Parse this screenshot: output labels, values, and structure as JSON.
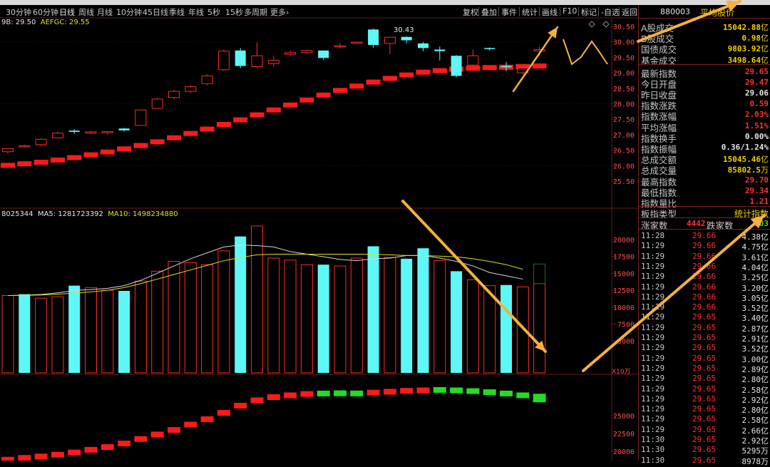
{
  "colors": {
    "up": "#ff2a2a",
    "down": "#5ef7f7",
    "ma_white": "#ffffff",
    "ma_yellow": "#e0e020",
    "grid": "#6a1a1a",
    "accent_yellow": "#f0d000",
    "arrow": "#f4b040"
  },
  "period_tabs": [
    {
      "label": "30分钟",
      "active": false
    },
    {
      "label": "60分钟",
      "active": false
    },
    {
      "label": "日线",
      "active": true
    },
    {
      "label": "周线",
      "active": false
    },
    {
      "label": "月线",
      "active": false
    },
    {
      "label": "10分钟",
      "active": false
    },
    {
      "label": "45日线",
      "active": false
    },
    {
      "label": "季线",
      "active": false
    },
    {
      "label": "年线",
      "active": false
    },
    {
      "label": "5秒",
      "active": false
    },
    {
      "label": "15秒",
      "active": false
    },
    {
      "label": "多周期",
      "active": false
    },
    {
      "label": "更多›",
      "active": false
    }
  ],
  "toolbar": [
    "复权",
    "叠加",
    "事件",
    "统计",
    "画线",
    "F10",
    "标记",
    "-自选",
    "返回"
  ],
  "legend": {
    "price": "9B: 29.50",
    "price_ma": "AEFGC: 29.55",
    "vol": "8025344",
    "vol_ma5": "MA5: 1281723392",
    "vol_ma10": "MA10: 1498234880",
    "high_label": "30.43",
    "vol_unit": "X10万"
  },
  "price_axis": [
    "30.50",
    "30.00",
    "29.50",
    "29.00",
    "28.50",
    "28.00",
    "27.50",
    "27.00",
    "26.50",
    "26.00",
    "25.50"
  ],
  "vol_axis": [
    "20000",
    "17500",
    "15000",
    "12500",
    "10000",
    "7500",
    "5000"
  ],
  "ind_axis": [
    "25000",
    "22500",
    "20000"
  ],
  "panel": {
    "code": "880003",
    "name": "平均股价",
    "stats": [
      {
        "label": "A股成交",
        "value": "15042.88",
        "unit": "亿",
        "color": "#f0d000"
      },
      {
        "label": "B股成交",
        "value": "0.98",
        "unit": "亿",
        "color": "#f0d000"
      },
      {
        "label": "国债成交",
        "value": "9803.92",
        "unit": "亿",
        "color": "#f0d000"
      },
      {
        "label": "基金成交",
        "value": "3498.64",
        "unit": "亿",
        "color": "#f0d000"
      },
      {
        "label": "最新指数",
        "value": "29.65",
        "unit": "",
        "color": "#ff3030"
      },
      {
        "label": "今日开盘",
        "value": "29.47",
        "unit": "",
        "color": "#ff3030"
      },
      {
        "label": "昨日收盘",
        "value": "29.06",
        "unit": "",
        "color": "#e6e6e6"
      },
      {
        "label": "指数涨跌",
        "value": "0.59",
        "unit": "",
        "color": "#ff3030"
      },
      {
        "label": "指数涨幅",
        "value": "2.03%",
        "unit": "",
        "color": "#ff3030"
      },
      {
        "label": "平均涨幅",
        "value": "1.51%",
        "unit": "",
        "color": "#ff3030"
      },
      {
        "label": "指数换手",
        "value": "0.00%",
        "unit": "",
        "color": "#e6e6e6"
      },
      {
        "label": "指数振幅",
        "value": "0.36/1.24%",
        "unit": "",
        "color": "#e6e6e6"
      },
      {
        "label": "总成交额",
        "value": "15045.46",
        "unit": "亿",
        "color": "#f0d000"
      },
      {
        "label": "总成交量",
        "value": "85802.5",
        "unit": "万",
        "color": "#f0d000"
      },
      {
        "label": "最高指数",
        "value": "29.70",
        "unit": "",
        "color": "#ff3030"
      },
      {
        "label": "最低指数",
        "value": "29.34",
        "unit": "",
        "color": "#ff3030"
      },
      {
        "label": "指数量比",
        "value": "1.21",
        "unit": "",
        "color": "#ff3030"
      }
    ],
    "board_label": "板指类型",
    "board_value": "统计指数",
    "up_label": "涨家数",
    "up_value": "4442",
    "down_label": "跌家数",
    "down_value": "903",
    "ticks": [
      {
        "time": "11:28",
        "price": "29.66",
        "vol": "4.38亿"
      },
      {
        "time": "11:29",
        "price": "29.66",
        "vol": "4.75亿"
      },
      {
        "time": "11:29",
        "price": "29.66",
        "vol": "3.61亿"
      },
      {
        "time": "11:29",
        "price": "29.66",
        "vol": "4.04亿"
      },
      {
        "time": "11:29",
        "price": "29.66",
        "vol": "3.25亿"
      },
      {
        "time": "11:29",
        "price": "29.66",
        "vol": "3.20亿"
      },
      {
        "time": "11:29",
        "price": "29.66",
        "vol": "3.05亿"
      },
      {
        "time": "11:29",
        "price": "29.66",
        "vol": "3.52亿"
      },
      {
        "time": "11:29",
        "price": "29.65",
        "vol": "3.40亿"
      },
      {
        "time": "11:29",
        "price": "29.65",
        "vol": "2.87亿"
      },
      {
        "time": "11:29",
        "price": "29.65",
        "vol": "2.91亿"
      },
      {
        "time": "11:29",
        "price": "29.65",
        "vol": "3.52亿"
      },
      {
        "time": "11:29",
        "price": "29.65",
        "vol": "3.00亿"
      },
      {
        "time": "11:29",
        "price": "29.65",
        "vol": "2.89亿"
      },
      {
        "time": "11:29",
        "price": "29.65",
        "vol": "2.80亿"
      },
      {
        "time": "11:29",
        "price": "29.65",
        "vol": "2.58亿"
      },
      {
        "time": "11:29",
        "price": "29.65",
        "vol": "2.92亿"
      },
      {
        "time": "11:29",
        "price": "29.65",
        "vol": "2.80亿"
      },
      {
        "time": "11:29",
        "price": "29.65",
        "vol": "2.58亿"
      },
      {
        "time": "11:29",
        "price": "29.65",
        "vol": "2.66亿"
      },
      {
        "time": "11:30",
        "price": "29.65",
        "vol": "2.92亿"
      },
      {
        "time": "11:30",
        "price": "29.65",
        "vol": "5295万"
      },
      {
        "time": "11:30",
        "price": "29.65",
        "vol": "8978万"
      }
    ]
  },
  "chart_data": {
    "type": "candlestick",
    "price_range": [
      25.25,
      30.75
    ],
    "candles": [
      {
        "o": 26.45,
        "h": 26.55,
        "c": 26.55,
        "l": 26.4
      },
      {
        "o": 26.62,
        "h": 26.68,
        "c": 26.64,
        "l": 26.58
      },
      {
        "o": 26.68,
        "h": 26.88,
        "c": 26.85,
        "l": 26.62
      },
      {
        "o": 26.9,
        "h": 27.1,
        "c": 27.05,
        "l": 26.88
      },
      {
        "o": 27.13,
        "h": 27.18,
        "c": 27.09,
        "l": 27.02
      },
      {
        "o": 27.05,
        "h": 27.12,
        "c": 27.09,
        "l": 27.02
      },
      {
        "o": 27.06,
        "h": 27.12,
        "c": 27.1,
        "l": 27.0
      },
      {
        "o": 27.2,
        "h": 27.22,
        "c": 27.14,
        "l": 27.1
      },
      {
        "o": 27.3,
        "h": 27.8,
        "c": 27.8,
        "l": 27.3
      },
      {
        "o": 27.85,
        "h": 28.2,
        "c": 28.15,
        "l": 27.85
      },
      {
        "o": 28.2,
        "h": 28.45,
        "c": 28.4,
        "l": 28.15
      },
      {
        "o": 28.4,
        "h": 28.6,
        "c": 28.55,
        "l": 28.35
      },
      {
        "o": 28.65,
        "h": 28.95,
        "c": 28.9,
        "l": 28.6
      },
      {
        "o": 29.1,
        "h": 29.75,
        "c": 29.7,
        "l": 29.05
      },
      {
        "o": 29.72,
        "h": 29.8,
        "c": 29.22,
        "l": 29.15
      },
      {
        "o": 29.2,
        "h": 29.98,
        "c": 29.55,
        "l": 29.15
      },
      {
        "o": 29.3,
        "h": 29.55,
        "c": 29.4,
        "l": 29.2
      },
      {
        "o": 29.6,
        "h": 29.72,
        "c": 29.65,
        "l": 29.55
      },
      {
        "o": 29.65,
        "h": 29.75,
        "c": 29.72,
        "l": 29.6
      },
      {
        "o": 29.72,
        "h": 29.72,
        "c": 29.48,
        "l": 29.42
      },
      {
        "o": 29.85,
        "h": 29.95,
        "c": 29.87,
        "l": 29.8
      },
      {
        "o": 29.97,
        "h": 30.0,
        "c": 29.99,
        "l": 29.95
      },
      {
        "o": 30.4,
        "h": 30.43,
        "c": 29.9,
        "l": 29.8
      },
      {
        "o": 29.95,
        "h": 30.15,
        "c": 30.15,
        "l": 29.6
      },
      {
        "o": 30.16,
        "h": 30.18,
        "c": 30.05,
        "l": 29.95
      },
      {
        "o": 29.95,
        "h": 30.0,
        "c": 29.8,
        "l": 29.7
      },
      {
        "o": 29.75,
        "h": 29.85,
        "c": 29.7,
        "l": 29.4
      },
      {
        "o": 29.55,
        "h": 29.57,
        "c": 28.9,
        "l": 28.85
      },
      {
        "o": 29.25,
        "h": 29.75,
        "c": 29.55,
        "l": 29.2
      },
      {
        "o": 29.8,
        "h": 29.82,
        "c": 29.78,
        "l": 29.72
      },
      {
        "o": 29.22,
        "h": 29.35,
        "c": 29.18,
        "l": 29.05
      },
      {
        "o": 29.0,
        "h": 29.2,
        "c": 29.15,
        "l": 28.95
      },
      {
        "o": 29.7,
        "h": 29.85,
        "c": 29.75,
        "l": 29.55
      }
    ],
    "ma": [
      26.01,
      26.06,
      26.11,
      26.18,
      26.26,
      26.35,
      26.44,
      26.54,
      26.65,
      26.77,
      26.9,
      27.04,
      27.18,
      27.33,
      27.48,
      27.64,
      27.8,
      27.96,
      28.12,
      28.28,
      28.43,
      28.57,
      28.7,
      28.82,
      28.93,
      29.02,
      29.07,
      29.12,
      29.15,
      29.17,
      29.18,
      29.2,
      29.22
    ],
    "vol_range": [
      0,
      22500
    ],
    "volumes": [
      11800,
      12000,
      11400,
      11600,
      13300,
      13000,
      12600,
      12500,
      14000,
      15500,
      17000,
      16800,
      16500,
      18600,
      20800,
      22400,
      17500,
      17200,
      16500,
      16500,
      16300,
      17500,
      19300,
      17600,
      17400,
      19000,
      17100,
      15500,
      14200,
      13300,
      13400,
      13100,
      13600
    ],
    "vol_down": [
      false,
      true,
      false,
      false,
      true,
      false,
      false,
      true,
      false,
      false,
      false,
      false,
      false,
      false,
      true,
      false,
      false,
      false,
      false,
      true,
      false,
      false,
      true,
      false,
      true,
      true,
      false,
      true,
      false,
      false,
      true,
      false,
      false
    ],
    "vol_ma5": [
      11800,
      11850,
      11950,
      12200,
      12550,
      12700,
      12900,
      13300,
      14100,
      15200,
      16300,
      17400,
      18300,
      19200,
      19500,
      19400,
      19200,
      18500,
      18100,
      17700,
      17300,
      17100,
      17400,
      17500,
      17900,
      17900,
      17500,
      17000,
      16300,
      15300,
      14800,
      14300
    ],
    "vol_ma10": [
      11800,
      11820,
      11880,
      12000,
      12150,
      12350,
      12600,
      13000,
      13600,
      14300,
      15000,
      15700,
      16400,
      17100,
      17600,
      18000,
      18100,
      18100,
      18100,
      18100,
      18100,
      18100,
      18100,
      18000,
      17900,
      17900,
      17800,
      17700,
      17400,
      17000,
      16500,
      15800
    ],
    "indicator": [
      19500,
      19700,
      19850,
      20050,
      20300,
      20600,
      20900,
      21300,
      21800,
      22300,
      22800,
      23400,
      24000,
      24700,
      25500,
      26100,
      26450,
      26650,
      26800,
      26850,
      26880,
      26860,
      26950,
      27050,
      27150,
      27200,
      27250,
      27200,
      27120,
      27000,
      26850,
      26650,
      26350
    ],
    "ind_down": [
      false,
      false,
      false,
      false,
      false,
      false,
      false,
      false,
      false,
      false,
      false,
      false,
      false,
      false,
      false,
      false,
      false,
      false,
      false,
      true,
      true,
      true,
      false,
      false,
      false,
      false,
      true,
      true,
      true,
      true,
      true,
      true,
      true
    ],
    "ind_range": [
      19400,
      27400
    ]
  }
}
